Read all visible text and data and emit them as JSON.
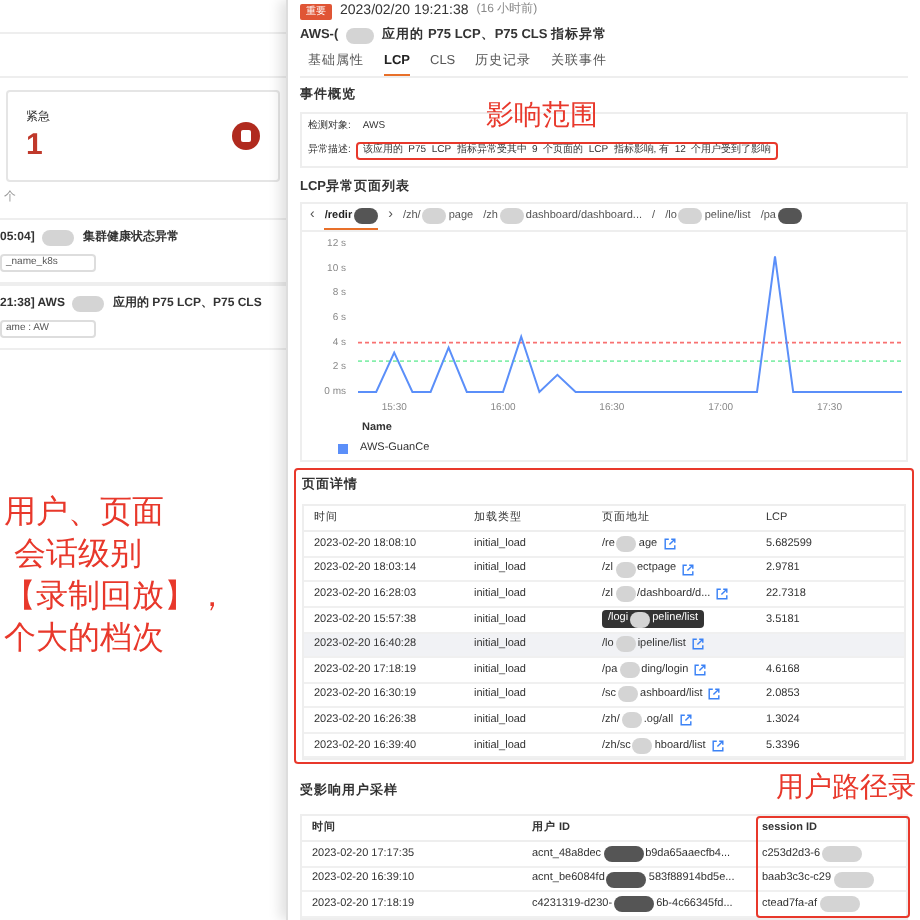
{
  "left_panel": {
    "status_card": {
      "label": "紧急",
      "count": "1"
    },
    "count_text": "个",
    "events": [
      {
        "time": "05:04]",
        "title": "集群健康状态异常",
        "tag": "_name_k8s"
      },
      {
        "time": "21:38] AWS",
        "title": "应用的 P75 LCP、P75 CLS",
        "tag": "ame : AW"
      }
    ],
    "annotation": [
      "用户、页面",
      "会话级别",
      "【录制回放】，",
      "个大的档次"
    ]
  },
  "drawer": {
    "badge": "重要",
    "time": "2023/02/20 19:21:38",
    "relative_time": "(16 小时前)",
    "title_prefix": "AWS-(",
    "title": "应用的 P75 LCP、P75 CLS 指标异常",
    "tabs": [
      {
        "label": "基础属性",
        "selected": false
      },
      {
        "label": "LCP",
        "selected": true
      },
      {
        "label": "CLS",
        "selected": false
      },
      {
        "label": "历史记录",
        "selected": false
      },
      {
        "label": "关联事件",
        "selected": false
      }
    ],
    "overview": {
      "heading": "事件概览",
      "annotation": "影响范围",
      "fields": [
        {
          "label": "检测对象:",
          "value": "AWS",
          "highlighted": false
        },
        {
          "label": "异常描述:",
          "value": "该应用的  P75  LCP  指标异常受其中  9  个页面的  LCP  指标影响, 有  12  个用户受到了影响",
          "highlighted": true
        }
      ]
    },
    "page_list": {
      "heading": "LCP异常页面列表",
      "prev": "‹",
      "next": "›",
      "tabs": [
        {
          "parts": [
            "/redir"
          ],
          "kind": "after",
          "selected": true
        },
        {
          "parts": [
            "/zh/",
            "page"
          ],
          "kind": "between",
          "selected": false
        },
        {
          "parts": [
            "/zh",
            "dashboard/dashboard..."
          ],
          "kind": "between",
          "selected": false
        },
        {
          "parts": [
            "/"
          ],
          "kind": "none",
          "selected": false
        },
        {
          "parts": [
            "/lo",
            "peline/list"
          ],
          "kind": "between",
          "selected": false
        },
        {
          "parts": [
            "/pa"
          ],
          "kind": "after",
          "selected": false
        }
      ],
      "chart_data": {
        "type": "line",
        "categories": [
          null,
          null,
          "15:30",
          null,
          null,
          null,
          null,
          null,
          "16:00",
          null,
          null,
          null,
          null,
          null,
          "16:30",
          null,
          null,
          null,
          null,
          null,
          "17:00",
          null,
          null,
          null,
          null,
          null,
          "17:30",
          null,
          null,
          null,
          null
        ],
        "series": [
          {
            "name": "AWS-GuanCe",
            "color": "#5b8ff9",
            "values": [
              0,
              0,
              3.2,
              0,
              0,
              3.6,
              0,
              0,
              0,
              4.5,
              0,
              1.4,
              0,
              0,
              0,
              0,
              0,
              0,
              0,
              0,
              0,
              0,
              0,
              11,
              0,
              0,
              0,
              0,
              0,
              0,
              0
            ]
          }
        ],
        "ylim": [
          0,
          12
        ],
        "yticks": [
          {
            "value": 0,
            "label": "0 ms"
          },
          {
            "value": 2,
            "label": "2 s"
          },
          {
            "value": 4,
            "label": "4 s"
          },
          {
            "value": 6,
            "label": "6 s"
          },
          {
            "value": 8,
            "label": "8 s"
          },
          {
            "value": 10,
            "label": "10 s"
          },
          {
            "value": 12,
            "label": "12 s"
          }
        ],
        "ref_lines": [
          {
            "axis": "y",
            "value": 4,
            "color": "#f87171"
          },
          {
            "axis": "y",
            "value": 2.5,
            "color": "#86efac"
          }
        ]
      },
      "legend_heading": "Name"
    },
    "page_details": {
      "heading": "页面详情",
      "highlighted": true,
      "columns": [
        "时间",
        "加载类型",
        "页面地址",
        "LCP"
      ],
      "rows": [
        {
          "time": "2023-02-20 18:08:10",
          "load": "initial_load",
          "address": [
            "/re",
            "age"
          ],
          "tooltip": false,
          "selected": false,
          "lcp": "5.682599"
        },
        {
          "time": "2023-02-20 18:03:14",
          "load": "initial_load",
          "address": [
            "/zl",
            "ectpage"
          ],
          "tooltip": false,
          "selected": false,
          "lcp": "2.9781"
        },
        {
          "time": "2023-02-20 16:28:03",
          "load": "initial_load",
          "address": [
            "/zl",
            "/dashboard/d..."
          ],
          "tooltip": false,
          "selected": false,
          "lcp": "22.7318"
        },
        {
          "time": "2023-02-20 15:57:38",
          "load": "initial_load",
          "address": [
            "/logi",
            "peline/list"
          ],
          "tooltip": true,
          "selected": false,
          "lcp": "3.5181"
        },
        {
          "time": "2023-02-20 16:40:28",
          "load": "initial_load",
          "address": [
            "/lo",
            "ipeline/list"
          ],
          "tooltip": false,
          "selected": true
        },
        {
          "time": "2023-02-20 17:18:19",
          "load": "initial_load",
          "address": [
            "/pa",
            "ding/login"
          ],
          "tooltip": false,
          "selected": false,
          "lcp": "4.6168"
        },
        {
          "time": "2023-02-20 16:30:19",
          "load": "initial_load",
          "address": [
            "/sc",
            "ashboard/list"
          ],
          "tooltip": false,
          "selected": false,
          "lcp": "2.0853"
        },
        {
          "time": "2023-02-20 16:26:38",
          "load": "initial_load",
          "address": [
            "/zh/",
            ".og/all"
          ],
          "tooltip": false,
          "selected": false,
          "lcp": "1.3024"
        },
        {
          "time": "2023-02-20 16:39:40",
          "load": "initial_load",
          "address": [
            "/zh/sc",
            "hboard/list"
          ],
          "tooltip": false,
          "selected": false,
          "lcp": "5.3396"
        }
      ]
    },
    "user_sample": {
      "heading": "受影响用户采样",
      "annotation": "用户路径录",
      "columns": [
        "时间",
        "用户 ID",
        "session ID"
      ],
      "rows": [
        {
          "time": "2023-02-20 17:17:35",
          "user_id": [
            "acnt_48a8dec",
            "b9da65aaecfb4..."
          ],
          "session_id": "c253d2d3-6"
        },
        {
          "time": "2023-02-20 16:39:10",
          "user_id": [
            "acnt_be6084fd",
            "583f88914bd5e..."
          ],
          "session_id": "baab3c3c-c29"
        },
        {
          "time": "2023-02-20 17:18:19",
          "user_id": [
            "c4231319-d230-",
            "6b-4c66345fd..."
          ],
          "session_id": "ctead7fa-af"
        }
      ]
    }
  }
}
